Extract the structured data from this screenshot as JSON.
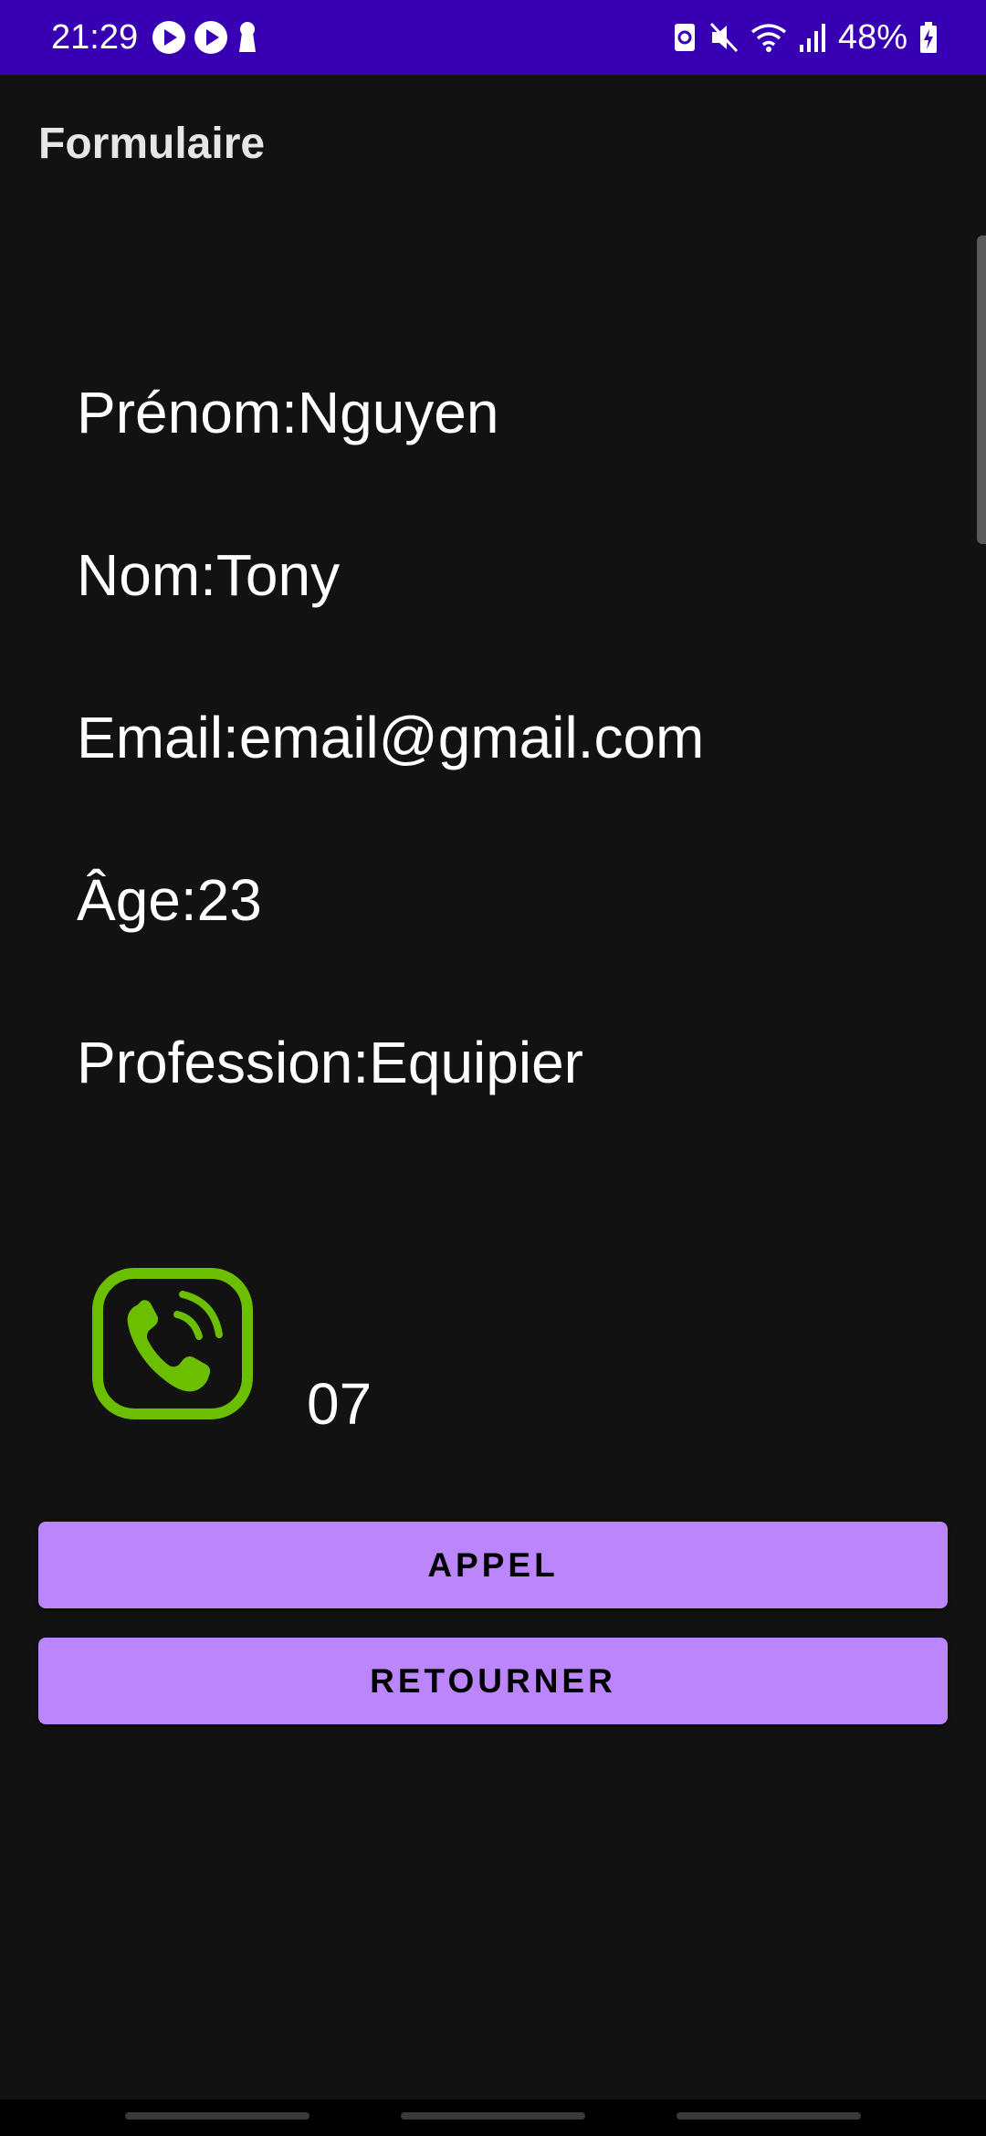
{
  "status_bar": {
    "time": "21:29",
    "battery": "48%",
    "background": "#3700b3",
    "left_icons": [
      "play-icon",
      "play-icon",
      "keyhole-icon"
    ],
    "right_icons": [
      "nfc-icon",
      "mute-icon",
      "wifi-icon",
      "signal-icon",
      "battery-icon"
    ]
  },
  "app_bar": {
    "title": "Formulaire"
  },
  "fields": {
    "prenom": "Prénom:Nguyen",
    "nom": "Nom:Tony",
    "email": "Email:email@gmail.com",
    "age": "Âge:23",
    "profession": "Profession:Equipier"
  },
  "phone": {
    "icon": "phone-call-icon",
    "icon_color": "#6cbf00",
    "number": "07"
  },
  "buttons": {
    "call_label": "APPEL",
    "back_label": "RETOURNER",
    "color": "#bb86fc"
  }
}
